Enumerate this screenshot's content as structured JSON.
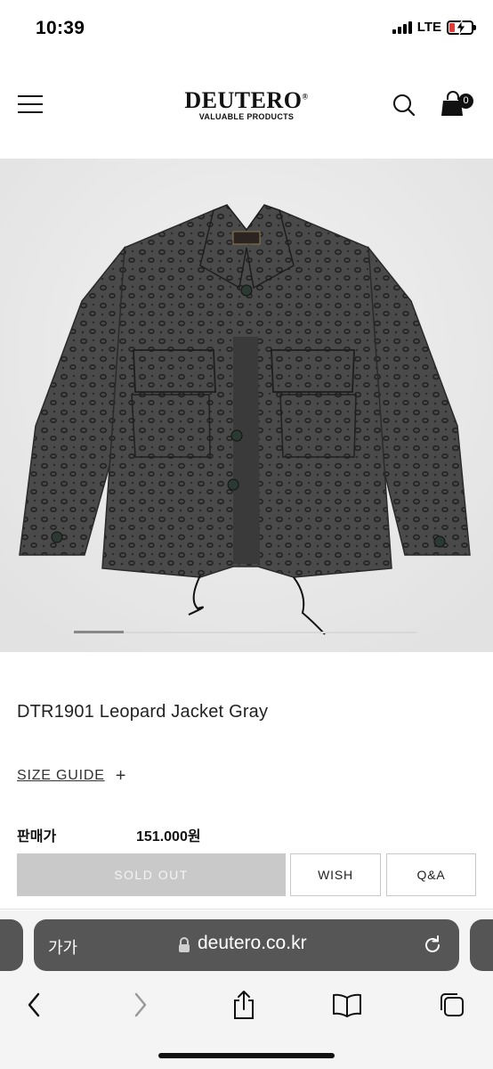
{
  "status_bar": {
    "time": "10:39",
    "network": "LTE",
    "battery_color": "#e53935"
  },
  "header": {
    "brand": "DEUTERO",
    "brand_mark": "®",
    "tagline": "VALUABLE PRODUCTS",
    "cart_count": "0",
    "icons": [
      "hamburger-menu-icon",
      "search-icon",
      "shopping-bag-icon"
    ]
  },
  "gallery": {
    "image_subject": "gray leopard print field jacket",
    "active_slide_fraction": 0.15
  },
  "product": {
    "title": "DTR1901 Leopard Jacket Gray",
    "size_guide_label": "SIZE GUIDE",
    "size_guide_icon": "+",
    "price_label": "판매가",
    "price_value": "151.000원"
  },
  "actions": {
    "sold_out": "SOLD OUT",
    "wish": "WISH",
    "qa": "Q&A"
  },
  "browser": {
    "text_size_label": "가가",
    "url": "deutero.co.kr",
    "toolbar_icons": [
      "back-icon",
      "forward-icon",
      "share-icon",
      "bookmarks-icon",
      "tabs-icon"
    ]
  }
}
